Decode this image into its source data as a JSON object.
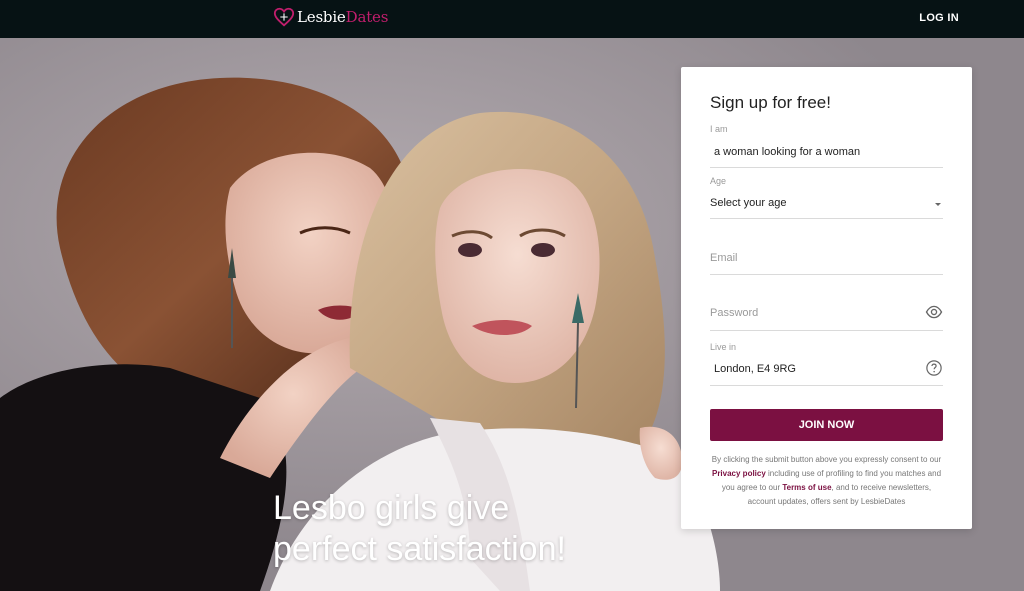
{
  "header": {
    "logo_text_main": "Lesbie",
    "logo_text_accent": "Dates",
    "login_label": "LOG IN"
  },
  "hero": {
    "headline_line1": "Lesbo girls give",
    "headline_line2": "perfect satisfaction!"
  },
  "signup": {
    "title": "Sign up for free!",
    "iam_label": "I am",
    "iam_value": "a woman looking for a woman",
    "age_label": "Age",
    "age_value": "Select your age",
    "email_placeholder": "Email",
    "password_placeholder": "Password",
    "location_label": "Live in",
    "location_value": "London, E4 9RG",
    "join_label": "JOIN NOW",
    "consent_pre": "By clicking the submit button above you expressly consent to our ",
    "privacy_link": "Privacy policy",
    "consent_mid": " including use of profiling to find you matches and you agree to our ",
    "terms_link": "Terms of use",
    "consent_post": ", and to receive newsletters, account updates, offers sent by LesbieDates"
  },
  "icons": {
    "logo": "heart-logo-icon",
    "password_toggle": "eye-icon",
    "location_help": "question-circle-icon",
    "age_dropdown": "caret-down-icon"
  },
  "colors": {
    "topbar": "#061214",
    "brand_accent": "#c01e6c",
    "button": "#7b1041",
    "card": "#ffffff"
  }
}
